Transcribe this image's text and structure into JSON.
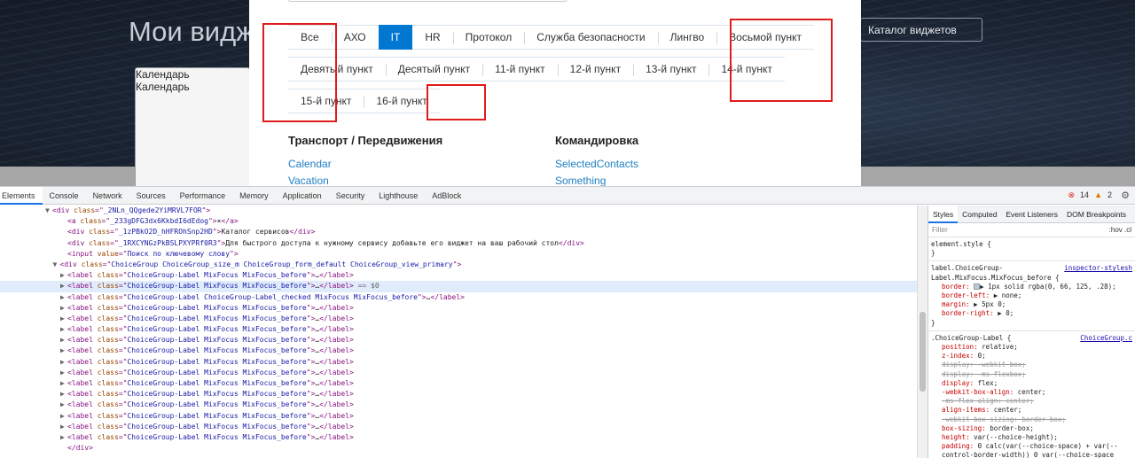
{
  "background_page": {
    "title": "Мои видж",
    "card_labels": [
      "Календарь",
      "Календарь"
    ],
    "catalog_button": "Каталог виджетов"
  },
  "modal": {
    "choice_rows": [
      [
        {
          "label": "Все",
          "checked": false
        },
        {
          "label": "АХО",
          "checked": false
        },
        {
          "label": "IT",
          "checked": true
        },
        {
          "label": "HR",
          "checked": false
        },
        {
          "label": "Протокол",
          "checked": false
        },
        {
          "label": "Служба безопасности",
          "checked": false
        },
        {
          "label": "Лингво",
          "checked": false
        },
        {
          "label": "Восьмой пункт",
          "checked": false
        }
      ],
      [
        {
          "label": "Девятый пункт",
          "checked": false
        },
        {
          "label": "Десятый пункт",
          "checked": false
        },
        {
          "label": "11-й пункт",
          "checked": false
        },
        {
          "label": "12-й пункт",
          "checked": false
        },
        {
          "label": "13-й пункт",
          "checked": false
        },
        {
          "label": "14-й пункт",
          "checked": false
        }
      ],
      [
        {
          "label": "15-й пункт",
          "checked": false
        },
        {
          "label": "16-й пункт",
          "checked": false
        }
      ]
    ],
    "categories": [
      {
        "title": "Транспорт / Передвижения",
        "links": [
          "Calendar",
          "Vacation"
        ]
      },
      {
        "title": "Командировка",
        "links": [
          "SelectedContacts",
          "Something"
        ]
      }
    ]
  },
  "devtools": {
    "tabs": [
      "Elements",
      "Console",
      "Network",
      "Sources",
      "Performance",
      "Memory",
      "Application",
      "Security",
      "Lighthouse",
      "AdBlock"
    ],
    "active_tab": "Elements",
    "errors": "14",
    "warnings": "2",
    "dom_lines": [
      {
        "indent": 6,
        "tri": "▼",
        "tag": "div",
        "attrs": [
          [
            "class",
            "_2NLn_QQgede2YiMRVL7FOR"
          ]
        ],
        "text": "",
        "close": false
      },
      {
        "indent": 8,
        "tri": "",
        "tag": "a",
        "attrs": [
          [
            "class",
            "_233gDFG3dx6KkbdI6dEdog"
          ]
        ],
        "text": "×",
        "close": true
      },
      {
        "indent": 8,
        "tri": "",
        "tag": "div",
        "attrs": [
          [
            "class",
            "_1zPBkO2D_hHFROhSnp2HD"
          ]
        ],
        "text": "Каталог сервисов",
        "close": true
      },
      {
        "indent": 8,
        "tri": "",
        "tag": "div",
        "attrs": [
          [
            "class",
            "_1RXCYNGzPkBSLPXYPRf0R3"
          ]
        ],
        "text": "Для быстрого доступа к нужному сервису добавьте его виджет на ваш рабочий стол",
        "close": true
      },
      {
        "indent": 8,
        "tri": "",
        "tag": "input",
        "attrs": [
          [
            "value",
            "Поиск по ключевому слову"
          ]
        ],
        "text": "",
        "close": false
      },
      {
        "indent": 7,
        "tri": "▼",
        "tag": "div",
        "attrs": [
          [
            "class",
            "ChoiceGroup ChoiceGroup_size_m ChoiceGroup_form_default ChoiceGroup_view_primary"
          ]
        ],
        "text": "",
        "close": false
      },
      {
        "indent": 8,
        "tri": "▶",
        "tag": "label",
        "attrs": [
          [
            "class",
            "ChoiceGroup-Label MixFocus MixFocus_before"
          ]
        ],
        "text": "…",
        "close": true
      },
      {
        "indent": 8,
        "tri": "▶",
        "tag": "label",
        "attrs": [
          [
            "class",
            "ChoiceGroup-Label MixFocus MixFocus_before"
          ]
        ],
        "text": "…",
        "close": true,
        "selected": true,
        "suffix": " == $0"
      },
      {
        "indent": 8,
        "tri": "▶",
        "tag": "label",
        "attrs": [
          [
            "class",
            "ChoiceGroup-Label ChoiceGroup-Label_checked MixFocus MixFocus_before"
          ]
        ],
        "text": "…",
        "close": true
      },
      {
        "indent": 8,
        "tri": "▶",
        "tag": "label",
        "attrs": [
          [
            "class",
            "ChoiceGroup-Label MixFocus MixFocus_before"
          ]
        ],
        "text": "…",
        "close": true
      },
      {
        "indent": 8,
        "tri": "▶",
        "tag": "label",
        "attrs": [
          [
            "class",
            "ChoiceGroup-Label MixFocus MixFocus_before"
          ]
        ],
        "text": "…",
        "close": true
      },
      {
        "indent": 8,
        "tri": "▶",
        "tag": "label",
        "attrs": [
          [
            "class",
            "ChoiceGroup-Label MixFocus MixFocus_before"
          ]
        ],
        "text": "…",
        "close": true
      },
      {
        "indent": 8,
        "tri": "▶",
        "tag": "label",
        "attrs": [
          [
            "class",
            "ChoiceGroup-Label MixFocus MixFocus_before"
          ]
        ],
        "text": "…",
        "close": true
      },
      {
        "indent": 8,
        "tri": "▶",
        "tag": "label",
        "attrs": [
          [
            "class",
            "ChoiceGroup-Label MixFocus MixFocus_before"
          ]
        ],
        "text": "…",
        "close": true
      },
      {
        "indent": 8,
        "tri": "▶",
        "tag": "label",
        "attrs": [
          [
            "class",
            "ChoiceGroup-Label MixFocus MixFocus_before"
          ]
        ],
        "text": "…",
        "close": true
      },
      {
        "indent": 8,
        "tri": "▶",
        "tag": "label",
        "attrs": [
          [
            "class",
            "ChoiceGroup-Label MixFocus MixFocus_before"
          ]
        ],
        "text": "…",
        "close": true
      },
      {
        "indent": 8,
        "tri": "▶",
        "tag": "label",
        "attrs": [
          [
            "class",
            "ChoiceGroup-Label MixFocus MixFocus_before"
          ]
        ],
        "text": "…",
        "close": true
      },
      {
        "indent": 8,
        "tri": "▶",
        "tag": "label",
        "attrs": [
          [
            "class",
            "ChoiceGroup-Label MixFocus MixFocus_before"
          ]
        ],
        "text": "…",
        "close": true
      },
      {
        "indent": 8,
        "tri": "▶",
        "tag": "label",
        "attrs": [
          [
            "class",
            "ChoiceGroup-Label MixFocus MixFocus_before"
          ]
        ],
        "text": "…",
        "close": true
      },
      {
        "indent": 8,
        "tri": "▶",
        "tag": "label",
        "attrs": [
          [
            "class",
            "ChoiceGroup-Label MixFocus MixFocus_before"
          ]
        ],
        "text": "…",
        "close": true
      },
      {
        "indent": 8,
        "tri": "▶",
        "tag": "label",
        "attrs": [
          [
            "class",
            "ChoiceGroup-Label MixFocus MixFocus_before"
          ]
        ],
        "text": "…",
        "close": true
      },
      {
        "indent": 8,
        "tri": "▶",
        "tag": "label",
        "attrs": [
          [
            "class",
            "ChoiceGroup-Label MixFocus MixFocus_before"
          ]
        ],
        "text": "…",
        "close": true
      },
      {
        "indent": 8,
        "tri": "",
        "tag": "/div",
        "attrs": [],
        "text": "",
        "close": false
      }
    ],
    "styles_panel": {
      "tabs": [
        "Styles",
        "Computed",
        "Event Listeners",
        "DOM Breakpoints"
      ],
      "active_tab": "Styles",
      "filter_placeholder": "Filter",
      "hov_label": ":hov  .cl",
      "rules": [
        {
          "selector": "element.style {",
          "source": "",
          "props": [],
          "close": "}"
        },
        {
          "selector": "label.ChoiceGroup-Label.MixFocus.MixFocus_before {",
          "source": "inspector-stylesh",
          "props": [
            {
              "name": "border",
              "value": "▶ 1px solid  rgba(0, 66, 125, .28);",
              "strike": false,
              "swatch": true
            },
            {
              "name": "border-left",
              "value": "▶ none;",
              "strike": false
            },
            {
              "name": "margin",
              "value": "▶ 5px 0;",
              "strike": false
            },
            {
              "name": "border-right",
              "value": "▶ 0;",
              "strike": false
            }
          ],
          "close": "}"
        },
        {
          "selector": ".ChoiceGroup-Label {",
          "source": "ChoiceGroup.c",
          "props": [
            {
              "name": "position",
              "value": "relative;",
              "strike": false
            },
            {
              "name": "z-index",
              "value": "0;",
              "strike": false
            },
            {
              "name": "display",
              "value": "-webkit-box;",
              "strike": true
            },
            {
              "name": "display",
              "value": "-ms-flexbox;",
              "strike": true
            },
            {
              "name": "display",
              "value": "flex;",
              "strike": false
            },
            {
              "name": "-webkit-box-align",
              "value": "center;",
              "strike": false
            },
            {
              "name": "-ms-flex-align",
              "value": "center;",
              "strike": true
            },
            {
              "name": "align-items",
              "value": "center;",
              "strike": false
            },
            {
              "name": "-webkit-box-sizing",
              "value": "border-box;",
              "strike": true
            },
            {
              "name": "box-sizing",
              "value": "border-box;",
              "strike": false
            },
            {
              "name": "height",
              "value": "var(--choice-height);",
              "strike": false
            },
            {
              "name": "padding",
              "value": "0 calc(var(--choice-space) + var(--",
              "strike": false
            },
            {
              "name": "",
              "value": "control-border-width)) 0 var(--choice-space",
              "strike": false
            }
          ],
          "close": ""
        }
      ]
    }
  }
}
